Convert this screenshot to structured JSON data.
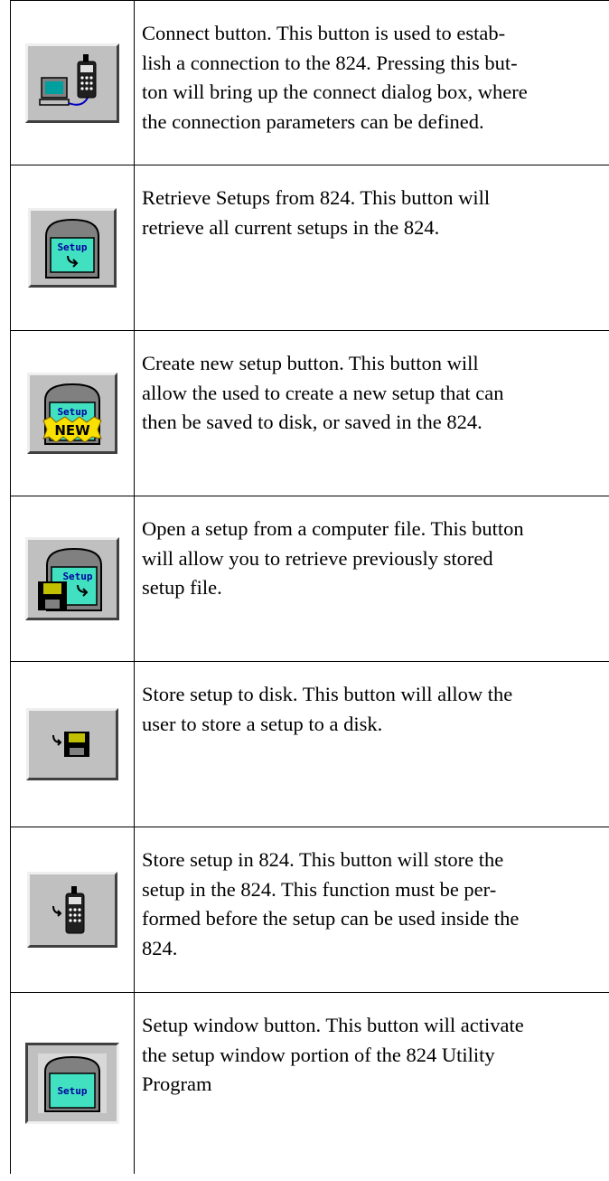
{
  "rows": [
    {
      "icon": "connect-computer-meter-icon",
      "text": "Connect button. This button is used to estab-\nlish a connection to the 824. Pressing this but-\nton will bring up the connect dialog box, where\nthe connection parameters can be defined."
    },
    {
      "icon": "retrieve-setup-icon",
      "icon_label": "Setup",
      "text": "Retrieve Setups from 824. This button will\nretrieve all current setups in the 824."
    },
    {
      "icon": "new-setup-icon",
      "icon_label": "Setup",
      "icon_badge": "NEW",
      "text": "Create new setup button. This button will\nallow the used to create a new setup that can\nthen be saved to disk, or saved in the 824."
    },
    {
      "icon": "open-setup-file-icon",
      "icon_label": "Setup",
      "text": "Open a setup from a computer file. This button\nwill allow you to retrieve previously stored\nsetup file."
    },
    {
      "icon": "store-to-disk-icon",
      "text": "Store setup to disk. This button will allow the\nuser to store a setup to a disk."
    },
    {
      "icon": "store-to-meter-icon",
      "text": "Store setup in 824. This button will store the\nsetup in the 824. This function must be per-\nformed before the setup can be used inside the\n824."
    },
    {
      "icon": "setup-window-icon",
      "icon_label": "Setup",
      "text": "Setup window button. This button will activate\nthe setup window portion of the 824 Utility\nProgram"
    }
  ]
}
